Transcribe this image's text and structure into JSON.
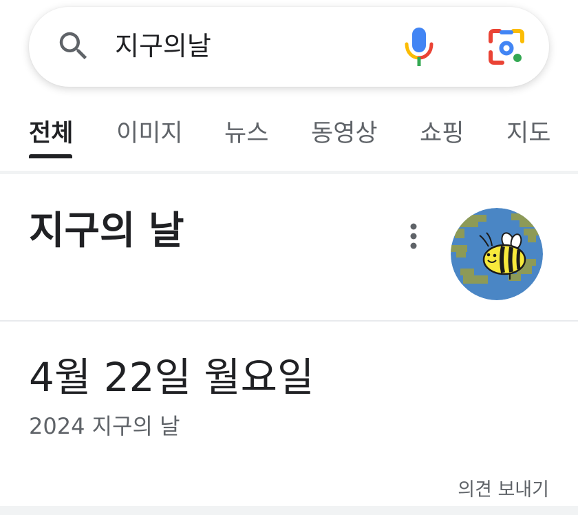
{
  "search": {
    "query": "지구의날",
    "icons": {
      "search": "search-icon",
      "voice": "microphone-icon",
      "lens": "google-lens-icon"
    },
    "colors": {
      "blue": "#4285f4",
      "red": "#ea4335",
      "yellow": "#fbbc04",
      "green": "#34a853"
    }
  },
  "tabs": [
    {
      "label": "전체",
      "active": true
    },
    {
      "label": "이미지",
      "active": false
    },
    {
      "label": "뉴스",
      "active": false
    },
    {
      "label": "동영상",
      "active": false
    },
    {
      "label": "쇼핑",
      "active": false
    },
    {
      "label": "지도",
      "active": false
    }
  ],
  "knowledge_panel": {
    "title": "지구의 날",
    "menu_icon": "more-vert-icon",
    "thumbnail": "earth-day-bee-doodle"
  },
  "answer": {
    "date": "4월 22일 월요일",
    "subtitle": "2024 지구의 날"
  },
  "feedback": {
    "label": "의견 보내기"
  }
}
